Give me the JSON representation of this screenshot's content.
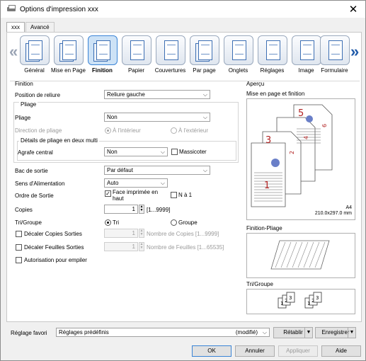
{
  "window": {
    "title": "Options d'impression xxx"
  },
  "tabs": [
    {
      "label": "xxx"
    },
    {
      "label": "Avancé"
    }
  ],
  "icons": [
    {
      "label": "Général",
      "icon": "general-icon"
    },
    {
      "label": "Mise en Page",
      "icon": "layout-icon"
    },
    {
      "label": "Finition",
      "icon": "finishing-icon"
    },
    {
      "label": "Papier",
      "icon": "paper-icon"
    },
    {
      "label": "Couvertures",
      "icon": "covers-icon"
    },
    {
      "label": "Par page",
      "icon": "per-page-icon"
    },
    {
      "label": "Onglets",
      "icon": "tabs-icon"
    },
    {
      "label": "Réglages",
      "icon": "settings-icon"
    },
    {
      "label": "Image",
      "icon": "image-icon"
    },
    {
      "label": "Formulaire",
      "icon": "form-icon"
    }
  ],
  "finition": {
    "section": "Finition",
    "position_label": "Position de reliure",
    "position_value": "Reliure gauche",
    "pliage_group": "Pliage",
    "pliage_label": "Pliage",
    "pliage_value": "Non",
    "direction_label": "Direction de pliage",
    "direction_inside": "À l'intérieur",
    "direction_outside": "À l'extérieur",
    "details_group": "Détails de pliage en deux multi",
    "agrafe_label": "Agrafe central",
    "agrafe_value": "Non",
    "massicoter_label": "Massicoter",
    "bac_label": "Bac de sortie",
    "bac_value": "Par défaut",
    "sens_label": "Sens d'Alimentation",
    "sens_value": "Auto",
    "ordre_label": "Ordre de Sortie",
    "face_label_1": "Face imprimée en",
    "face_label_2": "haut",
    "n1_label": "N à 1",
    "copies_label": "Copies",
    "copies_value": "1",
    "copies_range": "[1...9999]",
    "tri_label": "Tri/Groupe",
    "tri_option": "Tri",
    "groupe_option": "Groupe",
    "decaler_copies": "Décaler Copies Sorties",
    "decaler_copies_value": "1",
    "nb_copies_range": "Nombre de Copies [1...9999]",
    "decaler_feuilles": "Décaler Feuilles Sorties",
    "decaler_feuilles_value": "1",
    "nb_feuilles_range": "Nombre de Feuilles [1...65535]",
    "autorisation": "Autorisation pour empiler"
  },
  "apercu": {
    "section": "Aperçu",
    "mise_en_page": "Mise en page et finition",
    "paper_size": "A4",
    "paper_dims": "210.0x297.0 mm",
    "page_numbers": [
      "5",
      "6",
      "3",
      "4",
      "2",
      "1"
    ],
    "finition_pliage": "Finition-Pliage",
    "tri_groupe": "Tri/Groupe",
    "tri_numbers": [
      "1",
      "2",
      "3"
    ]
  },
  "footer": {
    "favori_label": "Réglage favori",
    "favori_value": "Réglages prédéfinis",
    "favori_state": "(modifié)",
    "retablir": "Rétablir",
    "enregistrer": "Enregistrer",
    "ok": "OK",
    "annuler": "Annuler",
    "appliquer": "Appliquer",
    "aide": "Aide"
  },
  "colors": {
    "accent": "#3a84d6",
    "page_number": "#b22222",
    "selected_icon_bg": "#cde2f6"
  }
}
